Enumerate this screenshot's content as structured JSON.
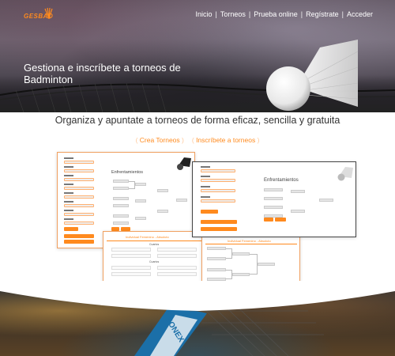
{
  "brand": {
    "logo_text": "GESBAD",
    "accent": "#ff8a1e"
  },
  "nav": {
    "items": [
      "Inicio",
      "Torneos",
      "Prueba online",
      "Regístrate",
      "Acceder"
    ],
    "separator": "|"
  },
  "hero": {
    "title": "Gestiona e inscríbete a torneos de Badminton"
  },
  "section": {
    "tagline": "Organiza y apuntate a torneos de forma eficaz, sencilla y gratuita",
    "tabs": [
      "Crea Torneos",
      "Inscríbete a torneos"
    ]
  },
  "screenshots": {
    "card1_title": "Enfrentamientos",
    "card2_title": "Enfrentamientos",
    "card3_title": "Individual Femenino - Absoluto",
    "card3_subtitle": "Cuartos",
    "card4_title": "Individual Femenino - Absoluto"
  },
  "icons": {
    "logo": "shuttlecock-logo-icon",
    "hero": "shuttlecock-icon"
  }
}
